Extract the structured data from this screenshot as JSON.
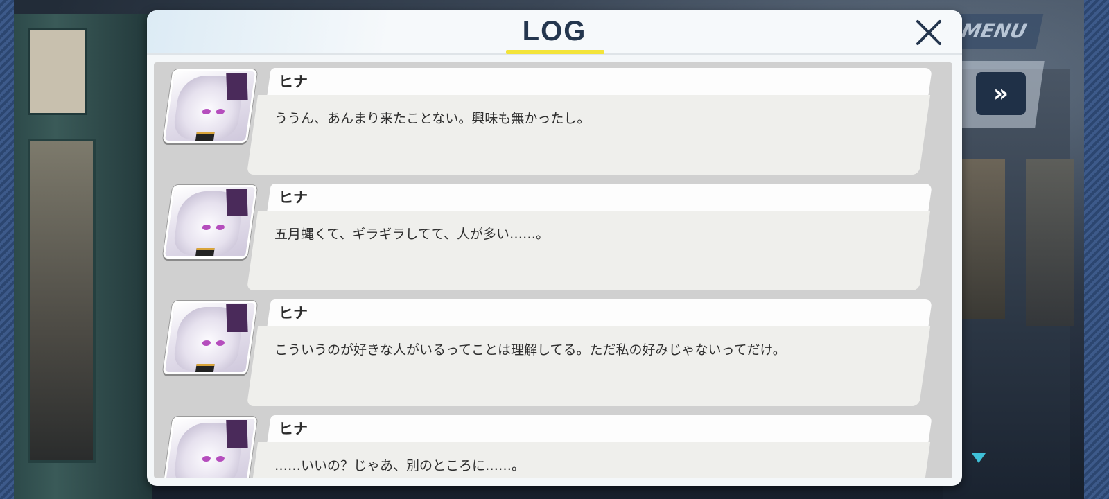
{
  "hud": {
    "menu_label": "MENU",
    "fast_forward_icon": "double-chevron-right-icon"
  },
  "log": {
    "title": "LOG",
    "close_icon": "close-x-icon",
    "entries": [
      {
        "speaker": "ヒナ",
        "text": "ううん、あんまり来たことない。興味も無かったし。"
      },
      {
        "speaker": "ヒナ",
        "text": "五月蝿くて、ギラギラしてて、人が多い……。"
      },
      {
        "speaker": "ヒナ",
        "text": "こういうのが好きな人がいるってことは理解してる。ただ私の好みじゃないってだけ。"
      },
      {
        "speaker": "ヒナ",
        "text": "……いいの？じゃあ、別のところに……。"
      }
    ]
  },
  "colors": {
    "title_text": "#24364e",
    "title_underline": "#f3e43a",
    "next_arrow": "#3fc0d8"
  }
}
